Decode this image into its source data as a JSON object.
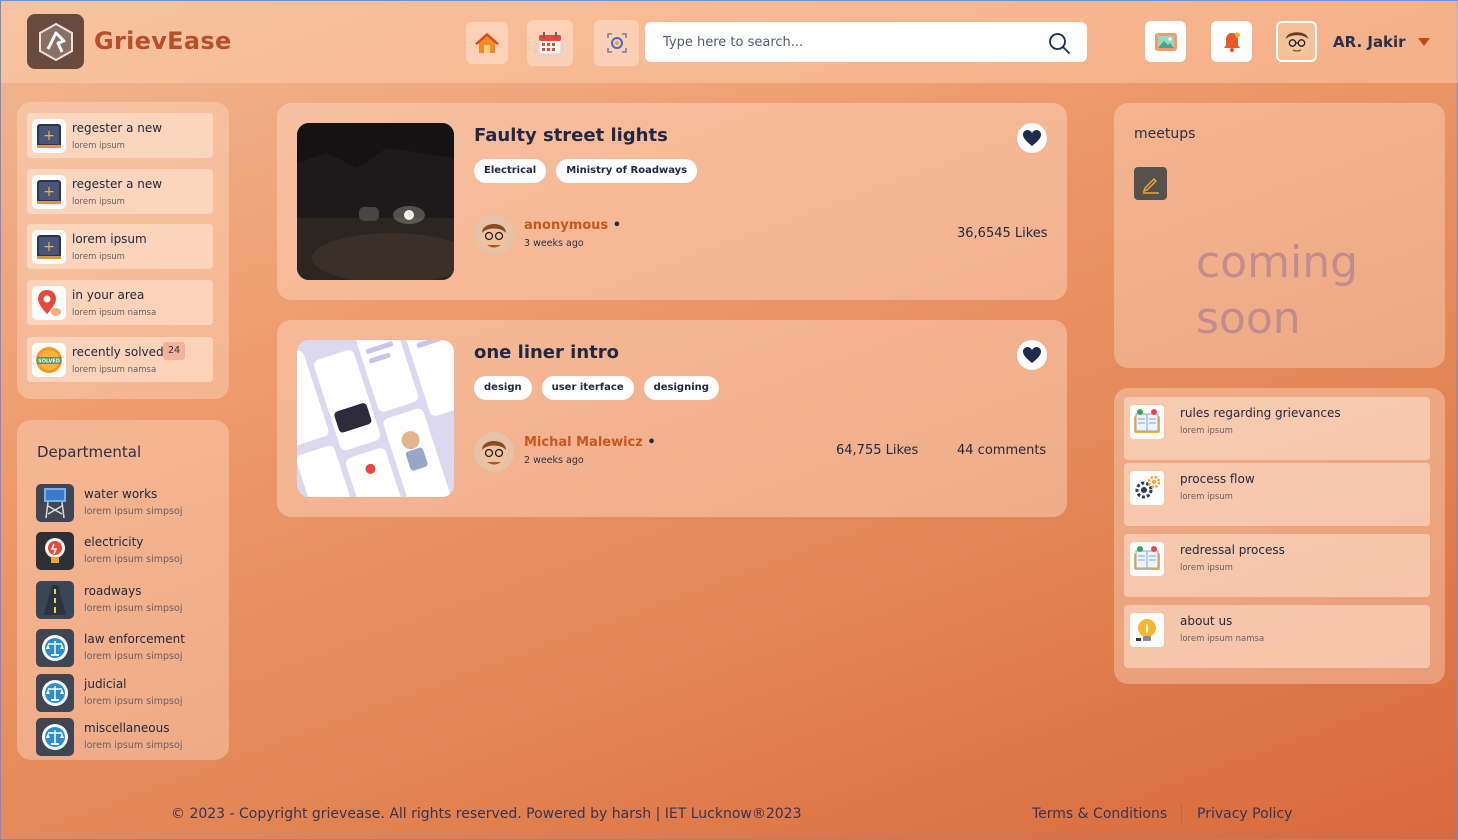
{
  "app": {
    "name": "GrievEase"
  },
  "search": {
    "placeholder": "Type here to search..."
  },
  "user": {
    "name": "AR. Jakir"
  },
  "quick_actions": [
    {
      "title": "regester a new",
      "subtitle": "lorem ipsum",
      "icon": "plus-icon"
    },
    {
      "title": "regester a new",
      "subtitle": "lorem ipsum",
      "icon": "plus-icon"
    },
    {
      "title": "lorem ipsum",
      "subtitle": "lorem ipsum",
      "icon": "plus-icon"
    },
    {
      "title": "in your area",
      "subtitle": "lorem ipsum  namsa",
      "icon": "map-pin-icon"
    },
    {
      "title": "recently solved",
      "subtitle": "lorem ipsum  namsa",
      "icon": "solved-stamp-icon",
      "badge": "24"
    }
  ],
  "departmental": {
    "title": "Departmental",
    "items": [
      {
        "title": "water works",
        "subtitle": "lorem ipsum simpsoj",
        "icon": "water-tower-icon"
      },
      {
        "title": "electricity",
        "subtitle": "lorem ipsum simpsoj",
        "icon": "bulb-icon"
      },
      {
        "title": "roadways",
        "subtitle": "lorem ipsum simpsoj",
        "icon": "road-icon"
      },
      {
        "title": "law enforcement",
        "subtitle": "lorem ipsum simpsoj",
        "icon": "scales-icon"
      },
      {
        "title": "judicial",
        "subtitle": "lorem ipsum simpsoj",
        "icon": "scales-icon"
      },
      {
        "title": "miscellaneous",
        "subtitle": "lorem ipsum simpsoj",
        "icon": "scales-icon"
      }
    ]
  },
  "posts": [
    {
      "title": "Faulty street lights",
      "tags": [
        "Electrical",
        "Ministry of Roadways"
      ],
      "author": "anonymous",
      "time": "3 weeks ago",
      "likes": "36,6545 Likes"
    },
    {
      "title": "one liner intro",
      "tags": [
        "design",
        "user iterface",
        "designing"
      ],
      "author": "Michal Malewicz",
      "time": "2 weeks ago",
      "likes": "64,755 Likes",
      "comments": "44 comments"
    }
  ],
  "meetups": {
    "title": "meetups",
    "coming_line1": "coming",
    "coming_line2": "soon"
  },
  "resources": [
    {
      "title": "rules regarding grievances",
      "subtitle": "lorem ipsum",
      "icon": "book-icon"
    },
    {
      "title": "process flow",
      "subtitle": "lorem ipsum",
      "icon": "gears-icon"
    },
    {
      "title": "redressal process",
      "subtitle": "lorem ipsum",
      "icon": "book-icon"
    },
    {
      "title": "about us",
      "subtitle": "lorem ipsum  namsa",
      "icon": "info-bulb-icon"
    }
  ],
  "footer": {
    "copyright": "© 2023 - Copyright  grievease. All rights reserved. Powered by harsh | IET Lucknow®2023",
    "terms": "Terms & Conditions",
    "privacy": "Privacy Policy"
  },
  "colors": {
    "brand": "#b84e2a",
    "accent": "#c8571e",
    "dark": "#232842"
  }
}
